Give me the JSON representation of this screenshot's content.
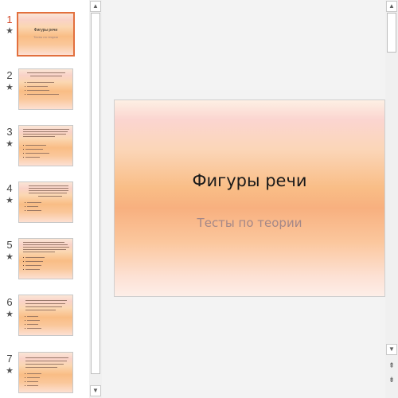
{
  "thumbnails": [
    {
      "number": "1",
      "star": "★",
      "title": "Фигуры речи",
      "subtitle": "Тесты по теории"
    },
    {
      "number": "2",
      "star": "★"
    },
    {
      "number": "3",
      "star": "★"
    },
    {
      "number": "4",
      "star": "★"
    },
    {
      "number": "5",
      "star": "★"
    },
    {
      "number": "6",
      "star": "★"
    },
    {
      "number": "7",
      "star": "★"
    }
  ],
  "main_slide": {
    "title": "Фигуры речи",
    "subtitle": "Тесты по теории"
  },
  "scrollbar": {
    "up_glyph": "▲",
    "down_glyph": "▼",
    "prev_slide_glyph": "⇞",
    "next_slide_glyph": "⇟"
  },
  "colors": {
    "active_accent": "#e2703e",
    "active_number": "#d24726"
  }
}
